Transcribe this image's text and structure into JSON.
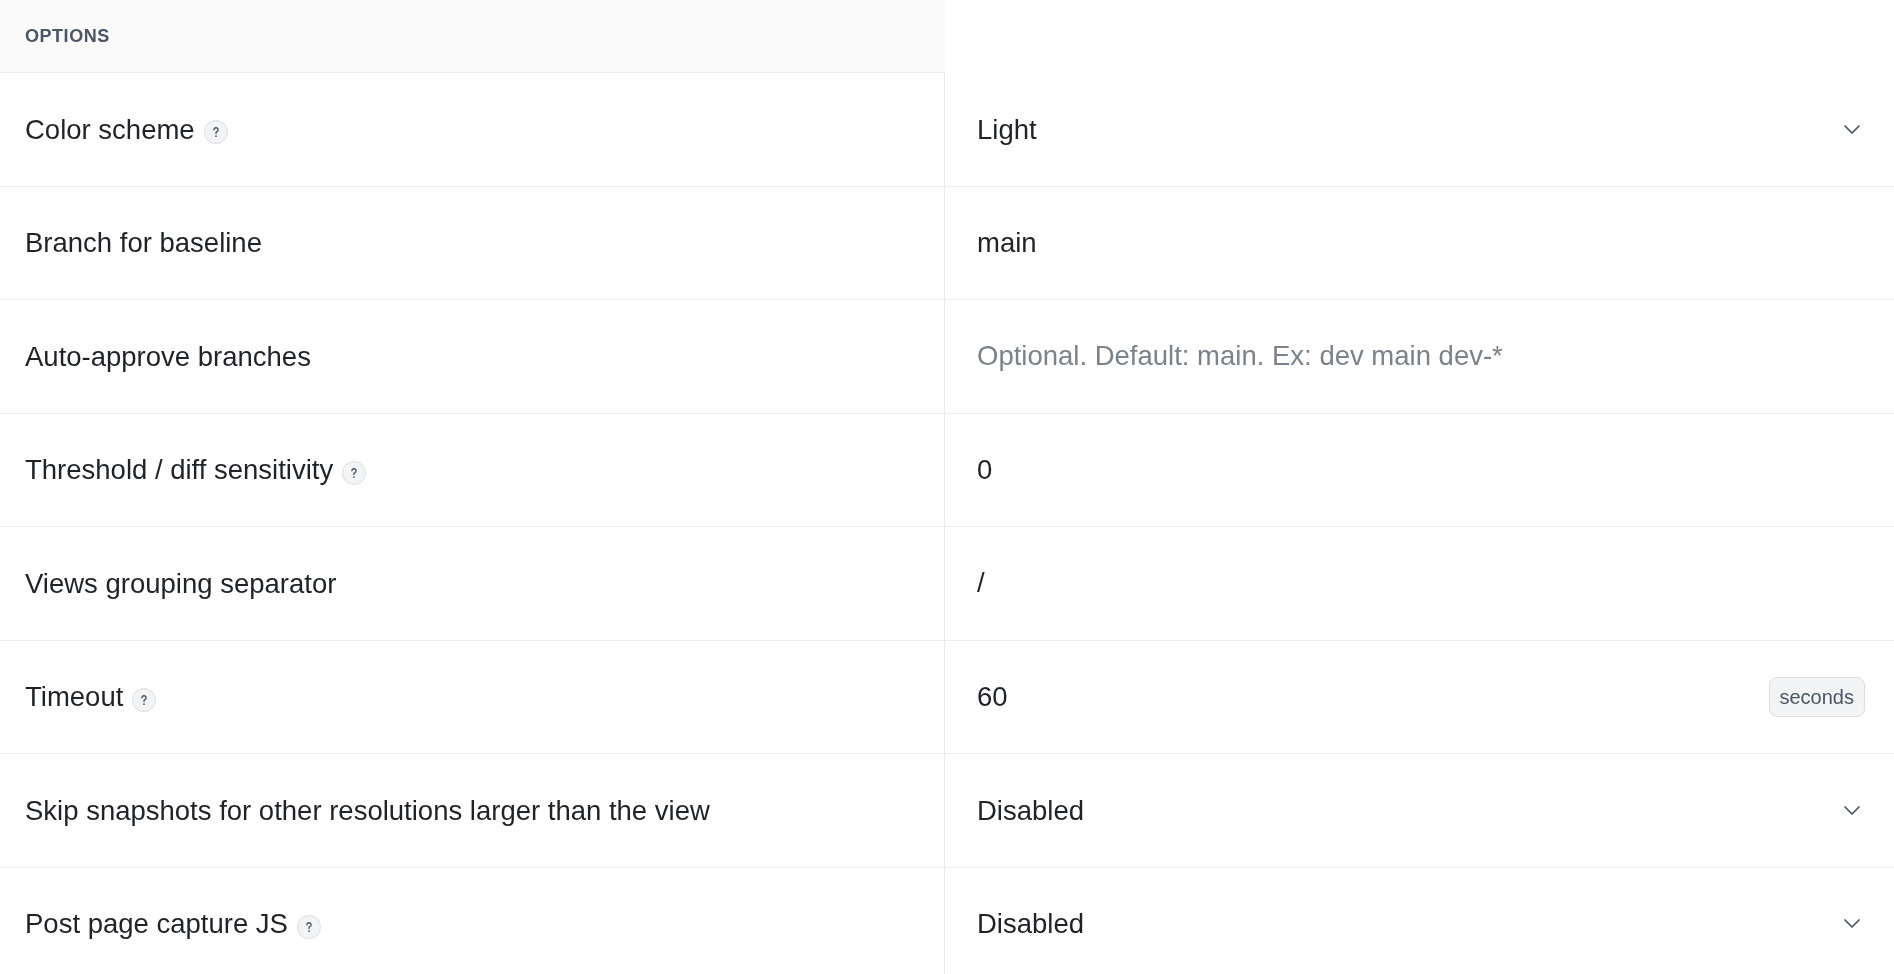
{
  "header": {
    "title": "OPTIONS"
  },
  "rows": [
    {
      "label": "Color scheme",
      "help": true,
      "kind": "select",
      "value": "Light"
    },
    {
      "label": "Branch for baseline",
      "help": false,
      "kind": "input",
      "value": "main"
    },
    {
      "label": "Auto-approve branches",
      "help": false,
      "kind": "input",
      "placeholder": "Optional. Default: main. Ex: dev main dev-*"
    },
    {
      "label": "Threshold / diff sensitivity",
      "help": true,
      "kind": "input",
      "value": "0"
    },
    {
      "label": "Views grouping separator",
      "help": false,
      "kind": "input",
      "value": "/"
    },
    {
      "label": "Timeout",
      "help": true,
      "kind": "input",
      "value": "60",
      "unit": "seconds"
    },
    {
      "label": "Skip snapshots for other resolutions larger than the view",
      "help": false,
      "kind": "select",
      "value": "Disabled"
    },
    {
      "label": "Post page capture JS",
      "help": true,
      "kind": "select",
      "value": "Disabled"
    }
  ]
}
